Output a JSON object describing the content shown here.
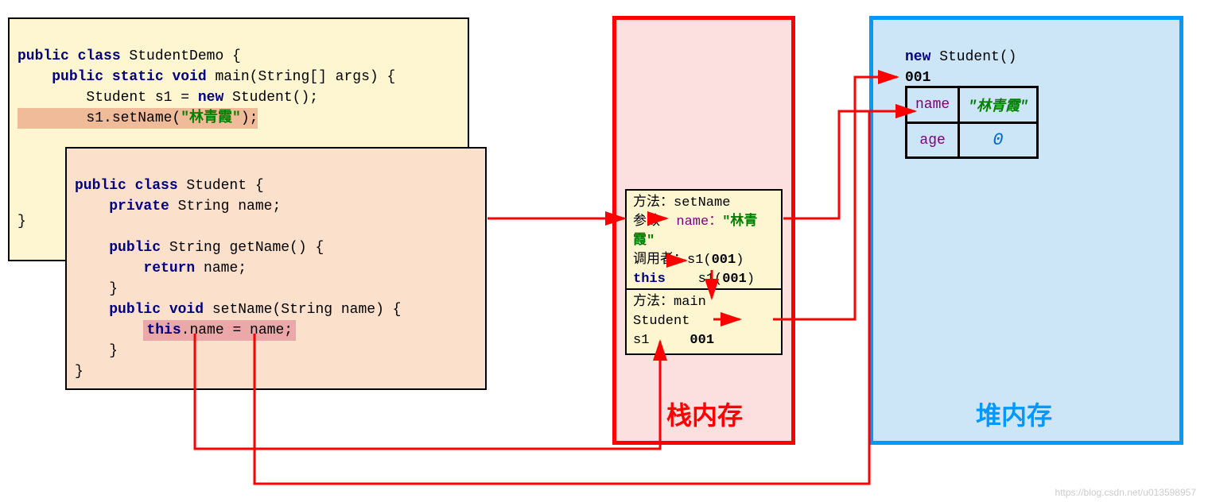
{
  "code1": {
    "l1a": "public class",
    "l1b": " StudentDemo {",
    "l2a": "public static void",
    "l2b": " main(String[] args) {",
    "l3a": "        Student s1 = ",
    "l3b": "new",
    "l3c": " Student();",
    "l4": "        s1.setName(",
    "l4s": "\"林青霞\"",
    "l4e": ");",
    "lend": "}"
  },
  "code2": {
    "l1a": "public class",
    "l1b": " Student {",
    "l2a": "private",
    "l2b": " String name;",
    "l3a": "public",
    "l3b": " String getName() {",
    "l4a": "return",
    "l4b": " name;",
    "l5a": "public void",
    "l5b": " setName(String name) {",
    "l6a": "this",
    "l6b": ".name = name;",
    "brace": "    }",
    "end": "}"
  },
  "stack": {
    "label": "栈内存",
    "f1_method": "方法：setName",
    "f1_param_lbl": "参数",
    "f1_param_name": "name：",
    "f1_param_val": "\"林青霞\"",
    "f1_caller": "调用者：s1(",
    "f1_caller_addr": "001",
    "f1_caller_end": ")",
    "f1_this": "this",
    "f1_this_val": "s1(",
    "f1_this_addr": "001",
    "f1_this_end": ")",
    "f2_method": "方法：main",
    "f2_var": " Student s1",
    "f2_addr": "001"
  },
  "heap": {
    "label": "堆内存",
    "new_kw": "new",
    "new_rest": " Student()",
    "addr": "001",
    "row1_k": "name",
    "row1_v": "\"林青霞\"",
    "row2_k": "age",
    "row2_v": "0"
  },
  "watermark": "https://blog.csdn.net/u013598957"
}
